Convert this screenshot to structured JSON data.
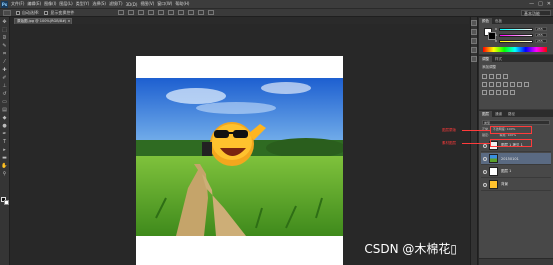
{
  "app": {
    "logo": "Ps",
    "menu": [
      "文件(F)",
      "编辑(E)",
      "图像(I)",
      "图层(L)",
      "类型(Y)",
      "选择(S)",
      "滤镜(T)",
      "3D(D)",
      "视图(V)",
      "窗口(W)",
      "帮助(H)"
    ],
    "window_buttons": [
      "—",
      "□",
      "✕"
    ]
  },
  "options_bar": {
    "auto_select_label": "自动选择:",
    "transform_label": "显示变换控件",
    "essentials": "基本功能"
  },
  "document": {
    "tab_title": "原始图.jpg @ 100%(RGB/8#) ×"
  },
  "panels": {
    "color_tabs": [
      "颜色",
      "色板"
    ],
    "sliders": [
      {
        "label": "R",
        "value": "255"
      },
      {
        "label": "G",
        "value": "255"
      },
      {
        "label": "B",
        "value": "255"
      }
    ],
    "adjust_tabs": [
      "调整",
      "样式"
    ],
    "adjust_label": "添加调整",
    "layers_tabs": [
      "图层",
      "通道",
      "路径"
    ],
    "layers_kind": "类型",
    "blend_mode": "正常",
    "opacity_label": "不透明度: 100%",
    "lock_label": "锁定:",
    "fill_label": "填充: 100%",
    "layers": [
      {
        "name": "图层 1 拷贝 1",
        "selected": false
      },
      {
        "name": "20150101",
        "selected": true
      },
      {
        "name": "图层 1",
        "selected": false
      },
      {
        "name": "背景",
        "selected": false
      }
    ]
  },
  "annotations": {
    "note1": "图层蒙版",
    "note2": "素材图层"
  },
  "watermark": "CSDN @木棉花▯",
  "colors": {
    "accent_red": "#ff3b3b",
    "selected_layer": "#5a6a82"
  }
}
